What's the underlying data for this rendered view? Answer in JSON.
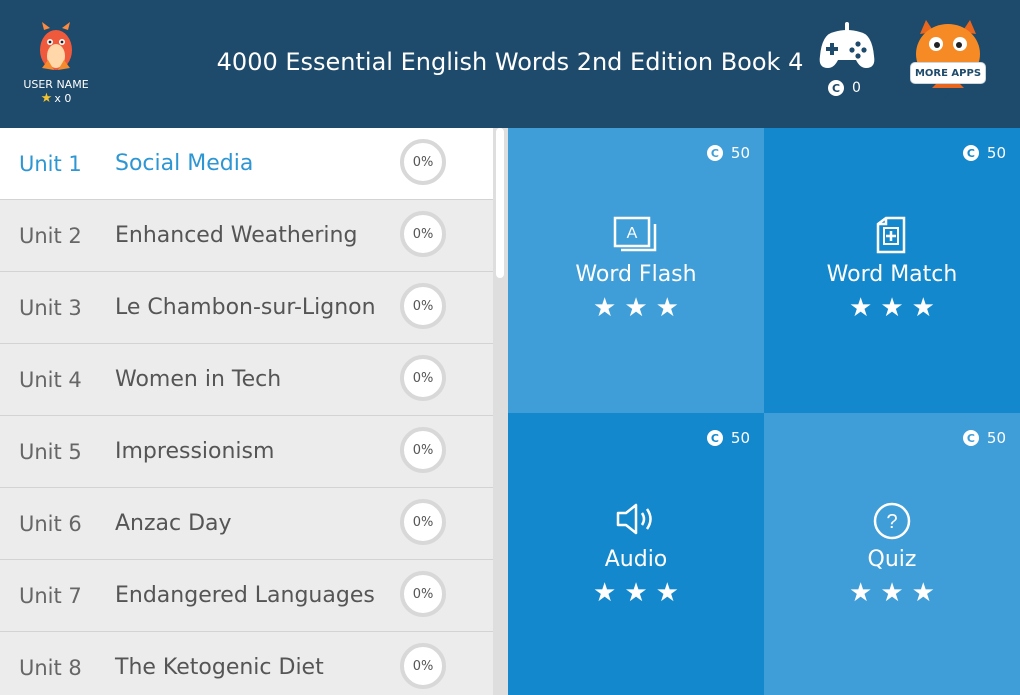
{
  "header": {
    "title": "4000 Essential English Words 2nd Edition Book 4",
    "user_name": "USER NAME",
    "star_count": "x 0",
    "coins": "0",
    "more_apps_label": "MORE APPS >"
  },
  "units": [
    {
      "number": "Unit 1",
      "title": "Social Media",
      "progress": "0%",
      "active": true
    },
    {
      "number": "Unit 2",
      "title": "Enhanced Weathering",
      "progress": "0%"
    },
    {
      "number": "Unit 3",
      "title": "Le Chambon-sur-Lignon",
      "progress": "0%"
    },
    {
      "number": "Unit 4",
      "title": "Women in Tech",
      "progress": "0%"
    },
    {
      "number": "Unit 5",
      "title": "Impressionism",
      "progress": "0%"
    },
    {
      "number": "Unit 6",
      "title": "Anzac Day",
      "progress": "0%"
    },
    {
      "number": "Unit 7",
      "title": "Endangered Languages",
      "progress": "0%"
    },
    {
      "number": "Unit 8",
      "title": "The Ketogenic Diet",
      "progress": "0%"
    }
  ],
  "activities": [
    {
      "label": "Word Flash",
      "cost": "50",
      "icon": "flashcard-icon",
      "stars": 3
    },
    {
      "label": "Word Match",
      "cost": "50",
      "icon": "card-add-icon",
      "stars": 3
    },
    {
      "label": "Audio",
      "cost": "50",
      "icon": "speaker-icon",
      "stars": 3
    },
    {
      "label": "Quiz",
      "cost": "50",
      "icon": "question-icon",
      "stars": 3
    }
  ],
  "colors": {
    "header_bg": "#1e4a6b",
    "accent": "#2d96d3",
    "tile_light": "#3f9ed8",
    "tile_dark": "#1388cc"
  }
}
